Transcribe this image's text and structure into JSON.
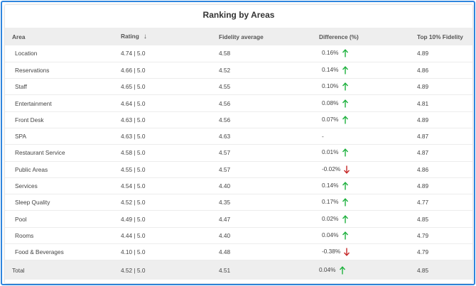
{
  "title": "Ranking by Areas",
  "columns": {
    "area": "Area",
    "rating": "Rating",
    "fidelity": "Fidelity average",
    "difference": "Difference (%)",
    "top10": "Top 10% Fidelity"
  },
  "sort_icon": "arrow-down-icon",
  "rows": [
    {
      "area": "Location",
      "rating": "4.74 | 5.0",
      "fidelity": "4.58",
      "difference": "0.16%",
      "trend": "up",
      "top10": "4.89"
    },
    {
      "area": "Reservations",
      "rating": "4.66 | 5.0",
      "fidelity": "4.52",
      "difference": "0.14%",
      "trend": "up",
      "top10": "4.86"
    },
    {
      "area": "Staff",
      "rating": "4.65 | 5.0",
      "fidelity": "4.55",
      "difference": "0.10%",
      "trend": "up",
      "top10": "4.89"
    },
    {
      "area": "Entertainment",
      "rating": "4.64 | 5.0",
      "fidelity": "4.56",
      "difference": "0.08%",
      "trend": "up",
      "top10": "4.81"
    },
    {
      "area": "Front Desk",
      "rating": "4.63 | 5.0",
      "fidelity": "4.56",
      "difference": "0.07%",
      "trend": "up",
      "top10": "4.89"
    },
    {
      "area": "SPA",
      "rating": "4.63 | 5.0",
      "fidelity": "4.63",
      "difference": "-",
      "trend": "none",
      "top10": "4.87"
    },
    {
      "area": "Restaurant Service",
      "rating": "4.58 | 5.0",
      "fidelity": "4.57",
      "difference": "0.01%",
      "trend": "up",
      "top10": "4.87"
    },
    {
      "area": "Public Areas",
      "rating": "4.55 | 5.0",
      "fidelity": "4.57",
      "difference": "-0.02%",
      "trend": "down",
      "top10": "4.86"
    },
    {
      "area": "Services",
      "rating": "4.54 | 5.0",
      "fidelity": "4.40",
      "difference": "0.14%",
      "trend": "up",
      "top10": "4.89"
    },
    {
      "area": "Sleep Quality",
      "rating": "4.52 | 5.0",
      "fidelity": "4.35",
      "difference": "0.17%",
      "trend": "up",
      "top10": "4.77"
    },
    {
      "area": "Pool",
      "rating": "4.49 | 5.0",
      "fidelity": "4.47",
      "difference": "0.02%",
      "trend": "up",
      "top10": "4.85"
    },
    {
      "area": "Rooms",
      "rating": "4.44 | 5.0",
      "fidelity": "4.40",
      "difference": "0.04%",
      "trend": "up",
      "top10": "4.79"
    },
    {
      "area": "Food & Beverages",
      "rating": "4.10 | 5.0",
      "fidelity": "4.48",
      "difference": "-0.38%",
      "trend": "down",
      "top10": "4.79"
    }
  ],
  "total": {
    "area": "Total",
    "rating": "4.52 | 5.0",
    "fidelity": "4.51",
    "difference": "0.04%",
    "trend": "up",
    "top10": "4.85"
  },
  "colors": {
    "up": "#1db13d",
    "down": "#c62828",
    "frame": "#2f86de"
  }
}
